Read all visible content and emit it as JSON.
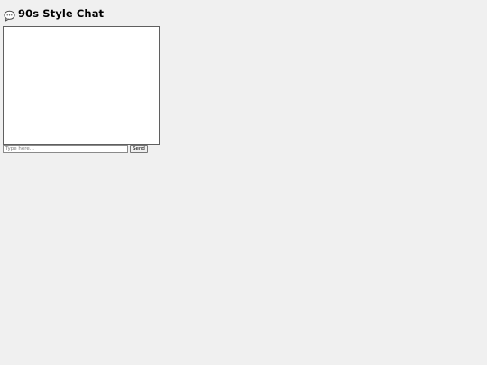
{
  "header": {
    "title": "90s Style Chat",
    "icon": "speech-bubble-icon"
  },
  "chat": {
    "messages": []
  },
  "composer": {
    "input_value": "",
    "input_placeholder": "Type here...",
    "send_label": "Send"
  }
}
